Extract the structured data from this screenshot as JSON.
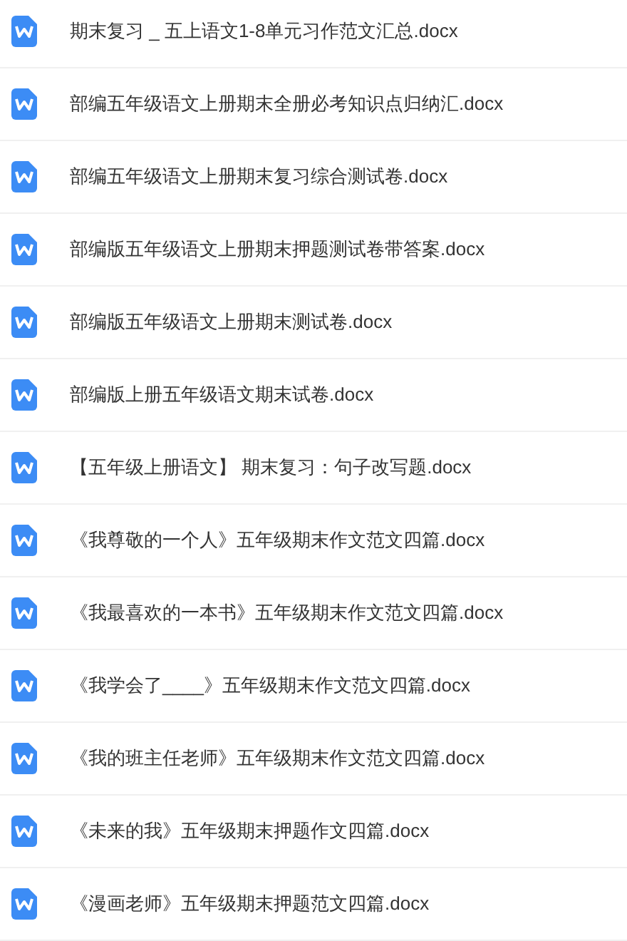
{
  "files": [
    {
      "name": "期末复习 _ 五上语文1-8单元习作范文汇总.docx"
    },
    {
      "name": "部编五年级语文上册期末全册必考知识点归纳汇.docx"
    },
    {
      "name": "部编五年级语文上册期末复习综合测试卷.docx"
    },
    {
      "name": "部编版五年级语文上册期末押题测试卷带答案.docx"
    },
    {
      "name": "部编版五年级语文上册期末测试卷.docx"
    },
    {
      "name": "部编版上册五年级语文期末试卷.docx"
    },
    {
      "name": "【五年级上册语文】 期末复习：句子改写题.docx"
    },
    {
      "name": "《我尊敬的一个人》五年级期末作文范文四篇.docx"
    },
    {
      "name": "《我最喜欢的一本书》五年级期末作文范文四篇.docx"
    },
    {
      "name": "《我学会了____》五年级期末作文范文四篇.docx"
    },
    {
      "name": "《我的班主任老师》五年级期末作文范文四篇.docx"
    },
    {
      "name": "《未来的我》五年级期末押题作文四篇.docx"
    },
    {
      "name": "《漫画老师》五年级期末押题范文四篇.docx"
    }
  ]
}
